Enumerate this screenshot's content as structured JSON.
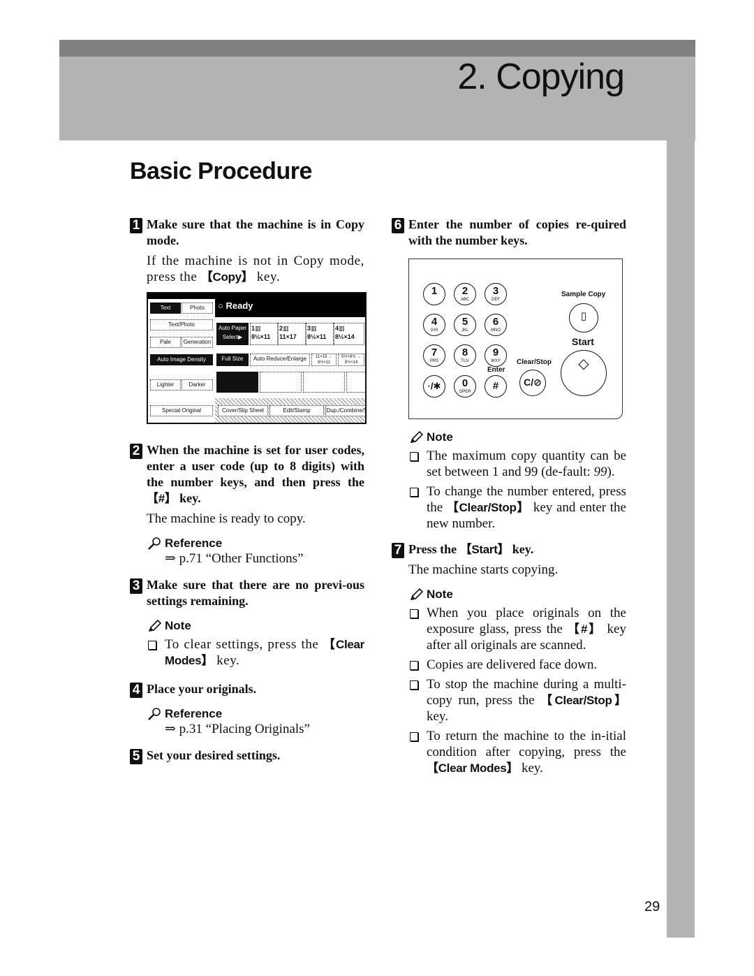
{
  "header": {
    "chapter_title": "2. Copying"
  },
  "section": {
    "title": "Basic Procedure"
  },
  "steps": [
    {
      "num": "1",
      "head": "Make sure that the machine is in Copy mode.",
      "body_pre": "If the machine is not in Copy mode, press the ",
      "body_key": "【Copy】",
      "body_post": " key."
    },
    {
      "num": "2",
      "head_pre": "When the machine is set for user codes, enter a user code (up to 8 digits) with the number keys, and then press the ",
      "head_key": "【#】",
      "head_post": " key.",
      "body": "The machine is ready to copy.",
      "reference_label": "Reference",
      "reference_link": "⇒ p.71 “Other Functions”"
    },
    {
      "num": "3",
      "head": "Make sure that there are no previ-ous settings remaining.",
      "note_label": "Note",
      "notes": [
        {
          "pre": "To clear settings, press the ",
          "key": "【Clear Modes】",
          "post": " key."
        }
      ]
    },
    {
      "num": "4",
      "head": "Place your originals.",
      "reference_label": "Reference",
      "reference_link": "⇒ p.31 “Placing Originals”"
    },
    {
      "num": "5",
      "head": "Set your desired settings."
    },
    {
      "num": "6",
      "head": "Enter the number of copies re-quired with the number keys.",
      "note_label": "Note",
      "notes": [
        {
          "pre": "The maximum copy quantity can be set between 1 and 99 (de-fault: ",
          "italic": "99",
          "post": ")."
        },
        {
          "pre": "To change the number entered, press the ",
          "key": "【Clear/Stop】",
          "post": " key and enter the new number."
        }
      ]
    },
    {
      "num": "7",
      "head_pre": "Press the ",
      "head_key": "【Start】",
      "head_post": " key.",
      "body": "The machine starts copying.",
      "note_label": "Note",
      "notes": [
        {
          "pre": "When you place originals on the exposure glass, press the ",
          "key": "【#】",
          "post": " key after all originals are scanned."
        },
        {
          "pre": "Copies are delivered face down."
        },
        {
          "pre": "To stop the machine during a multi-copy run, press the ",
          "key": "【Clear/Stop】",
          "post": " key."
        },
        {
          "pre": "To return the machine to the in-itial condition after copying, press the ",
          "key": "【Clear Modes】",
          "post": " key."
        }
      ]
    }
  ],
  "touch_panel": {
    "status": "Ready",
    "buttons": {
      "text": "Text",
      "photo": "Photo",
      "text_photo": "Text/Photo",
      "pale": "Pale",
      "generation": "Generation",
      "auto_image_density": "Auto Image Density",
      "lighter": "Lighter",
      "darker": "Darker",
      "special_original": "Special Original",
      "auto_paper_select": "Auto Paper Select▶",
      "full_size": "Full Size",
      "auto_reduce_enlarge": "Auto Reduce/Enlarge",
      "ratio_1": "11×15 → 8½×11",
      "ratio_2": "5½×8½ → 8½×14",
      "cover_slip_sheet": "Cover/Slip Sheet",
      "edit_stamp": "Edit/Stamp",
      "dup_combine": "Dup./Combine/S"
    },
    "trays": [
      {
        "num": "1",
        "size": "8½×11"
      },
      {
        "num": "2",
        "size": "11×17"
      },
      {
        "num": "3",
        "size": "8½×11"
      },
      {
        "num": "4",
        "size": "8½×14"
      }
    ]
  },
  "keypad": {
    "keys": [
      {
        "d": "1",
        "l": ""
      },
      {
        "d": "2",
        "l": "ABC"
      },
      {
        "d": "3",
        "l": "DEF"
      },
      {
        "d": "4",
        "l": "GHI"
      },
      {
        "d": "5",
        "l": "JKL"
      },
      {
        "d": "6",
        "l": "MNO"
      },
      {
        "d": "7",
        "l": "PRS"
      },
      {
        "d": "8",
        "l": "TUV"
      },
      {
        "d": "9",
        "l": "WXY"
      },
      {
        "d": "·/✱",
        "l": ""
      },
      {
        "d": "0",
        "l": "OPER"
      },
      {
        "d": "#",
        "l": ""
      }
    ],
    "enter_label": "Enter",
    "clear_stop_label": "Clear/Stop",
    "clear_stop_glyph": "C/⊘",
    "sample_copy_label": "Sample Copy",
    "start_label": "Start",
    "start_glyph": "◇"
  },
  "footer": {
    "page_number": "29"
  }
}
